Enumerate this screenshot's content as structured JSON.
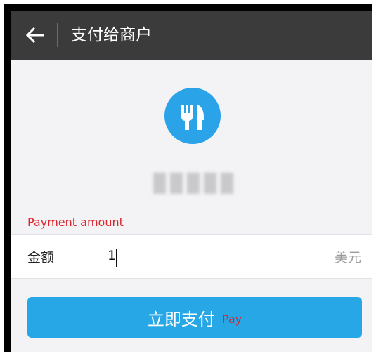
{
  "header": {
    "title": "支付给商户",
    "back_icon": "arrow-left-icon"
  },
  "merchant": {
    "icon": "fork-knife-icon",
    "name_blurred": true,
    "logo_color": "#2aa3e8"
  },
  "annotations": {
    "payment_amount": "Payment amount",
    "pay": "Pay"
  },
  "amount_field": {
    "label": "金额",
    "value": "1",
    "currency": "美元"
  },
  "pay_button": {
    "label": "立即支付",
    "color": "#28a7e6"
  },
  "colors": {
    "topbar": "#3b3b3b",
    "background": "#f3f3f6",
    "annotation": "#d8262b"
  }
}
